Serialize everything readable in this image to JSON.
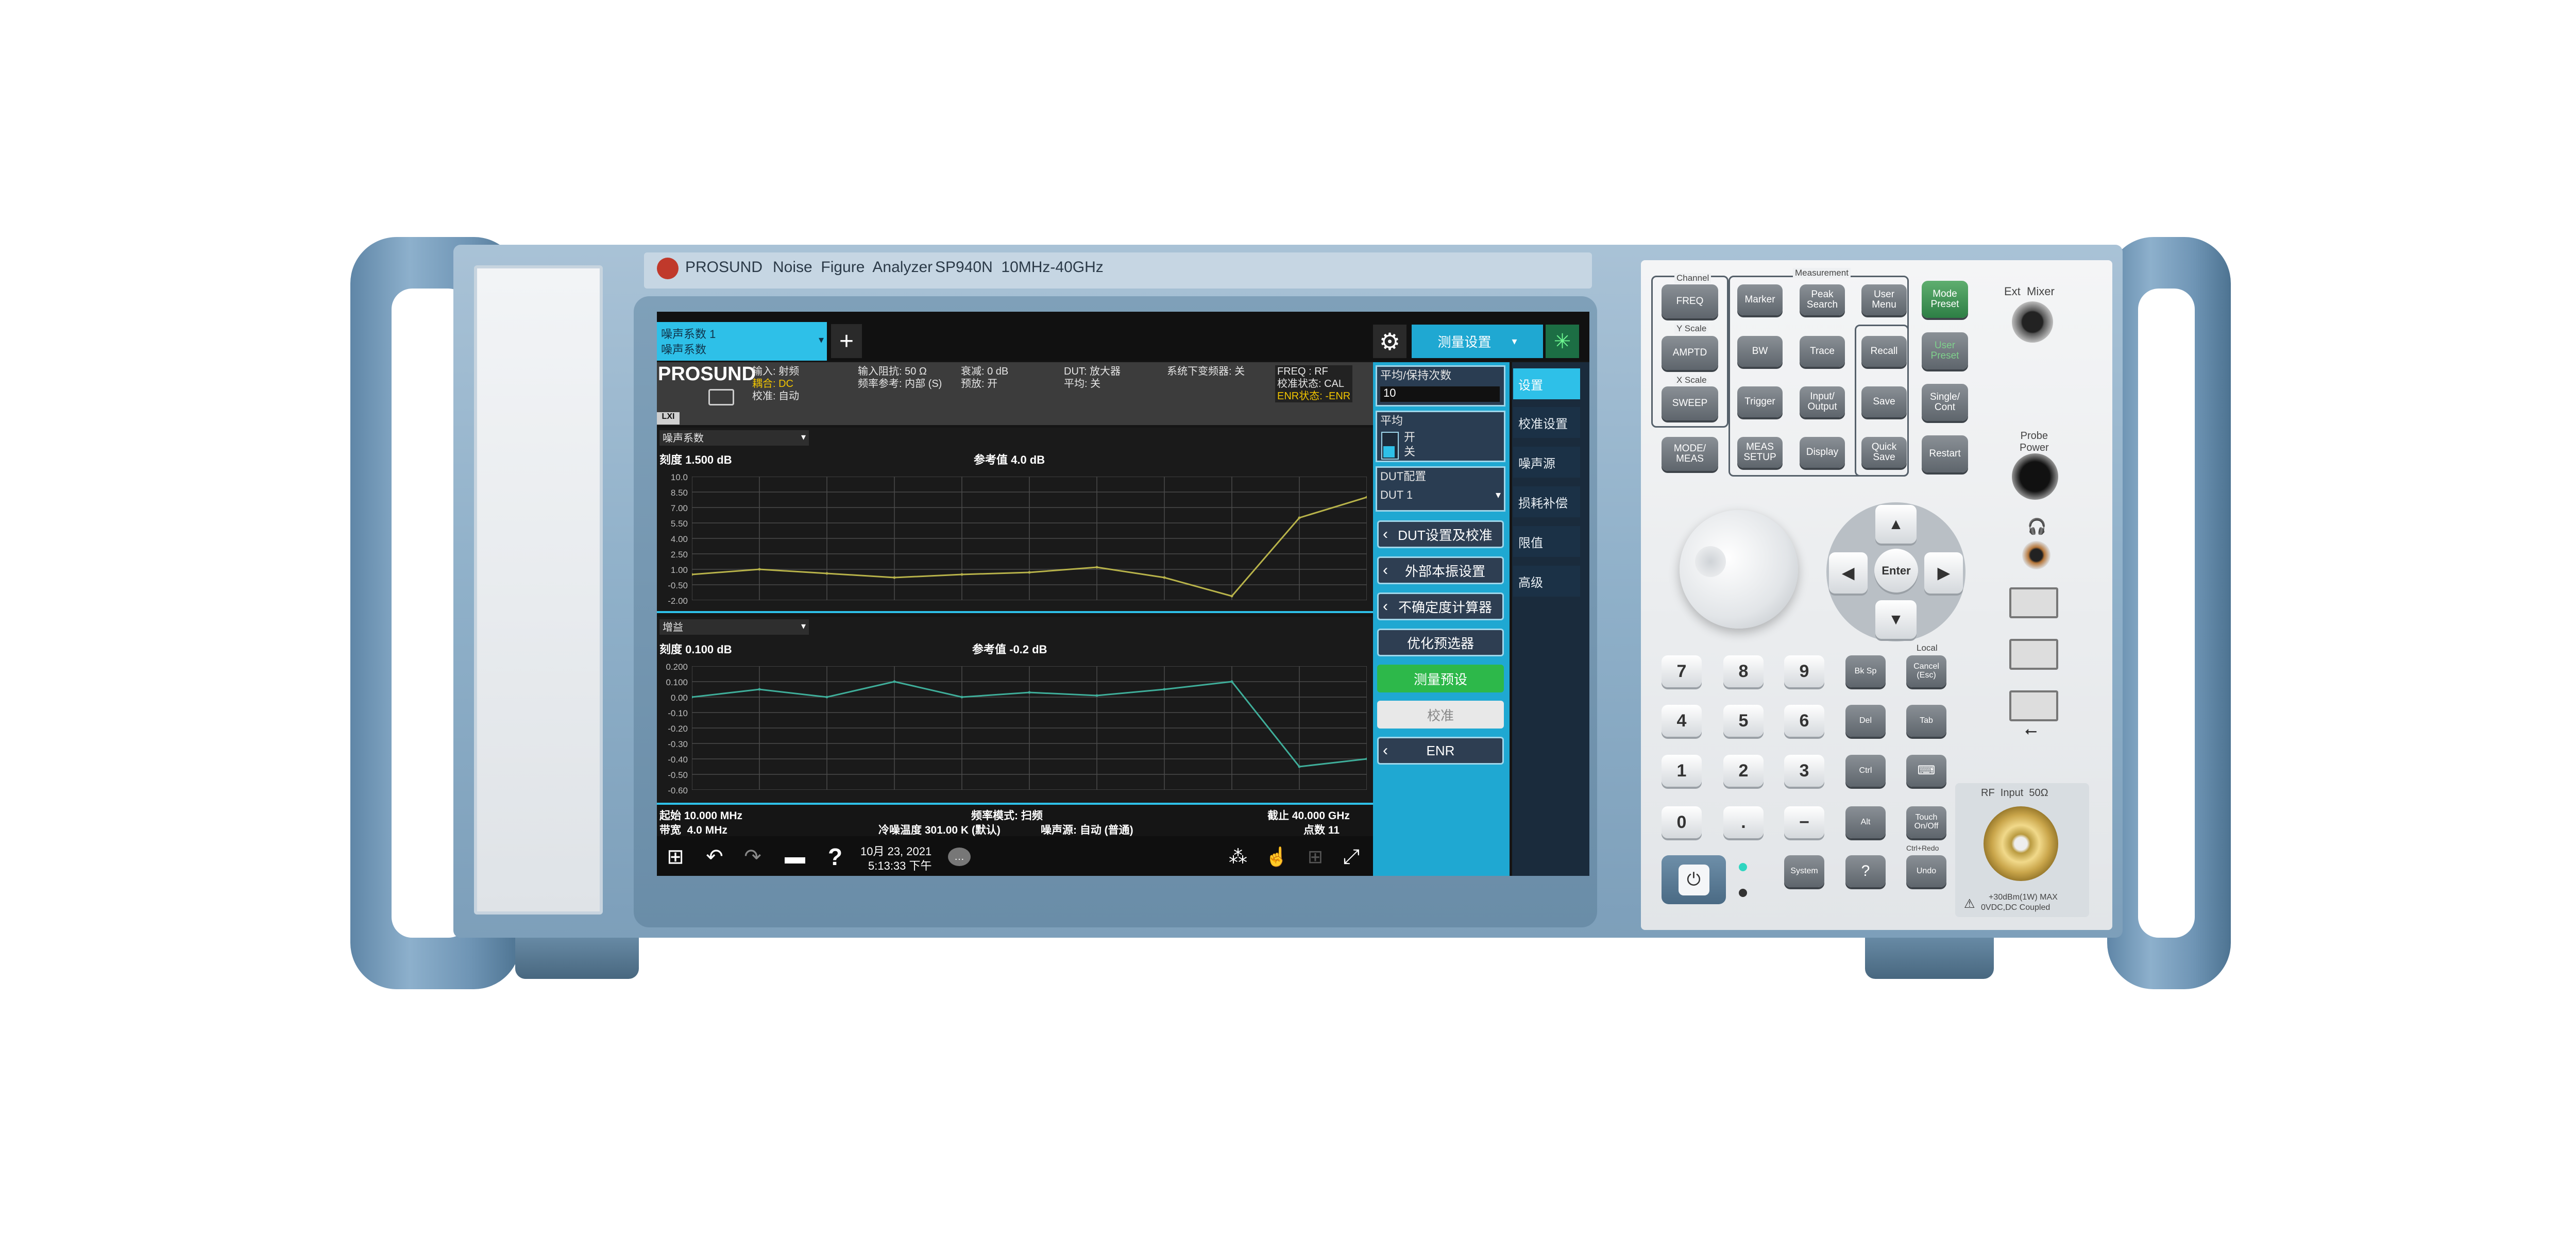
{
  "brand": {
    "logo_text": "PROSUND",
    "product": "Noise  Figure  Analyzer",
    "model": "SP940N  10MHz-40GHz"
  },
  "top_bar": {
    "measurement_tab_line1": "噪声系数 1",
    "measurement_tab_line2": "噪声系数",
    "add_label": "+",
    "menu_title": "测量设置"
  },
  "status": {
    "logo": "PROSUND",
    "col1": [
      "输入: 射频",
      "耦合: DC",
      "校准: 自动"
    ],
    "col2": [
      "输入阻抗: 50 Ω",
      "频率参考: 内部 (S)"
    ],
    "col3": [
      "衰减: 0 dB",
      "预放: 开"
    ],
    "col4": [
      "DUT: 放大器",
      "平均: 关"
    ],
    "col5": [
      "系统下变频器: 关"
    ],
    "col6": [
      "FREQ : RF",
      "校准状态: CAL",
      "ENR状态: -ENR"
    ]
  },
  "lxi": "LXI",
  "trace1": {
    "selector": "噪声系数",
    "scale": "刻度 1.500 dB",
    "ref": "参考值 4.0 dB",
    "yticks": [
      "10.0",
      "8.50",
      "7.00",
      "5.50",
      "4.00",
      "2.50",
      "1.00",
      "-0.50",
      "-2.00"
    ]
  },
  "trace2": {
    "selector": "增益",
    "scale": "刻度 0.100 dB",
    "ref": "参考值 -0.2 dB",
    "yticks": [
      "0.200",
      "0.100",
      "0.00",
      "-0.10",
      "-0.20",
      "-0.30",
      "-0.40",
      "-0.50",
      "-0.60"
    ]
  },
  "footer": {
    "start": "起始 10.000 MHz",
    "sweep_mode": "频率模式: 扫频",
    "stop": "截止 40.000 GHz",
    "bw": "带宽  4.0 MHz",
    "cold_temp": "冷噪温度 301.00 K (默认)",
    "noise_source": "噪声源: 自动 (普通)",
    "points": "点数 11"
  },
  "taskbar": {
    "date": "10月 23, 2021",
    "time": "5:13:33 下午"
  },
  "menu": {
    "avg_hold_label": "平均/保持次数",
    "avg_hold_value": "10",
    "avg_label": "平均",
    "avg_on": "开",
    "avg_off": "关",
    "dut_cfg_label": "DUT配置",
    "dut_value": "DUT 1",
    "buttons": [
      "DUT设置及校准",
      "外部本振设置",
      "不确定度计算器",
      "优化预选器",
      "测量预设",
      "校准",
      "ENR"
    ]
  },
  "side_tabs": [
    "设置",
    "校准设置",
    "噪声源",
    "损耗补偿",
    "限值",
    "高级"
  ],
  "keys": {
    "group_labels": {
      "channel": "Channel",
      "measurement": "Measurement",
      "y_scale": "Y Scale",
      "x_scale": "X Scale",
      "local": "Local",
      "ctrl_undo": "Ctrl+Redo"
    },
    "row1": [
      "FREQ",
      "Marker",
      "Peak\nSearch",
      "User\nMenu",
      "Mode\nPreset"
    ],
    "row2": [
      "AMPTD",
      "BW",
      "Trace",
      "Recall",
      "User\nPreset"
    ],
    "row3": [
      "SWEEP",
      "Trigger",
      "Input/\nOutput",
      "Save",
      "Single/\nCont"
    ],
    "row4": [
      "MODE/\nMEAS",
      "MEAS\nSETUP",
      "Display",
      "Quick\nSave",
      "Restart"
    ],
    "ext_mixer": "Ext  Mixer",
    "probe_power": "Probe\nPower",
    "enter": "Enter",
    "num": [
      [
        "7",
        "8",
        "9",
        "Bk Sp",
        "Cancel\n(Esc)"
      ],
      [
        "4",
        "5",
        "6",
        "Del",
        "Tab"
      ],
      [
        "1",
        "2",
        "3",
        "Ctrl",
        ""
      ],
      [
        "0",
        ".",
        "−",
        "Alt",
        "Touch\nOn/Off"
      ]
    ],
    "system": "System",
    "help": "?",
    "undo": "Undo",
    "rf_input": "RF  Input  50Ω",
    "rf_warn1": "+30dBm(1W) MAX",
    "rf_warn2": "0VDC,DC Coupled"
  },
  "colors": {
    "nf_trace": "#b8b34a",
    "gain_trace": "#3fae9a",
    "accent": "#23b9e0",
    "menu_bg": "#1fa8d2",
    "green_btn": "#2db84a"
  },
  "chart_data": [
    {
      "type": "line",
      "title": "",
      "ylabel": "噪声系数",
      "ylim": [
        -2.0,
        10.0
      ],
      "x": [
        1,
        2,
        3,
        4,
        5,
        6,
        7,
        8,
        9,
        10,
        11
      ],
      "series": [
        {
          "name": "",
          "values": [
            0.5,
            1.0,
            0.6,
            0.2,
            0.5,
            0.7,
            1.2,
            0.2,
            -1.6,
            6.0,
            8.0
          ]
        }
      ]
    },
    {
      "type": "line",
      "title": "",
      "ylabel": "增益",
      "ylim": [
        -0.6,
        0.2
      ],
      "x": [
        1,
        2,
        3,
        4,
        5,
        6,
        7,
        8,
        9,
        10,
        11
      ],
      "series": [
        {
          "name": "",
          "values": [
            0.0,
            0.05,
            0.0,
            0.1,
            0.0,
            0.03,
            0.01,
            0.05,
            0.1,
            -0.45,
            -0.4
          ]
        }
      ]
    }
  ]
}
